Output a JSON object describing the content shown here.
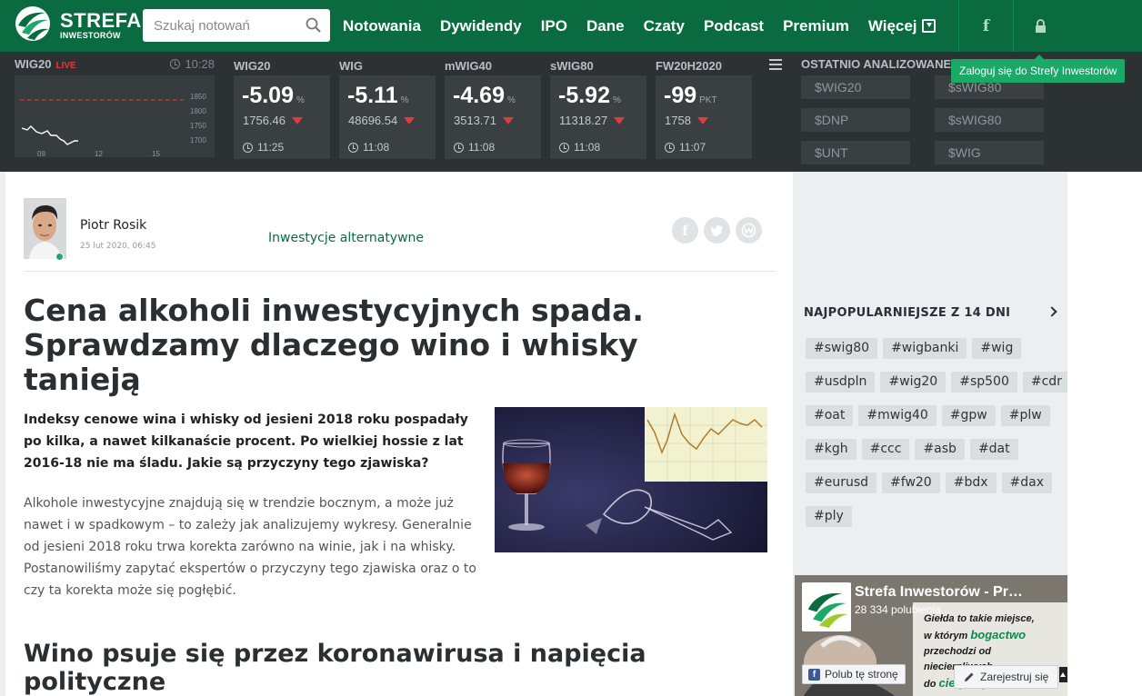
{
  "brand": {
    "name": "STREFA",
    "subtitle": "INWESTORÓW",
    "color": "#0b6b40",
    "accent": "#1aa967"
  },
  "search": {
    "placeholder": "Szukaj notowań",
    "icon": "search-icon"
  },
  "nav": {
    "links": [
      "Notowania",
      "Dywidendy",
      "IPO",
      "Dane",
      "Czaty",
      "Podcast",
      "Premium",
      "Więcej"
    ],
    "facebook_icon": "facebook-icon",
    "lock_icon": "lock-icon"
  },
  "login_tooltip": "Zaloguj się do Strefy Inwestorów",
  "ticker": {
    "live_index": {
      "name": "WIG20",
      "live_label": "LIVE",
      "time": "10:28",
      "y_ticks": [
        "1850",
        "1800",
        "1750",
        "1700"
      ],
      "x_ticks": [
        "09",
        "12",
        "15"
      ]
    },
    "indices": [
      {
        "name": "WIG20",
        "change": "-5.09",
        "unit": "%",
        "value": "1756.46",
        "time": "11:25"
      },
      {
        "name": "WIG",
        "change": "-5.11",
        "unit": "%",
        "value": "48696.54",
        "time": "11:08"
      },
      {
        "name": "mWIG40",
        "change": "-4.69",
        "unit": "%",
        "value": "3513.71",
        "time": "11:08"
      },
      {
        "name": "sWIG80",
        "change": "-5.92",
        "unit": "%",
        "value": "11318.27",
        "time": "11:08"
      },
      {
        "name": "FW20H2020",
        "change": "-99",
        "unit": "PKT",
        "value": "1758",
        "time": "11:07"
      }
    ],
    "recent_label": "OSTATNIO ANALIZOWANE",
    "recent": [
      "$WIG20",
      "$sWIG80",
      "$DNP",
      "$sWIG80",
      "$UNT",
      "$WIG"
    ]
  },
  "article": {
    "author": "Piotr Rosik",
    "date": "25 lut 2020, 06:45",
    "category": "Inwestycje alternatywne",
    "title_line1": "Cena alkoholi inwestycyjnych spada.",
    "title_line2": "Sprawdzamy dlaczego wino i whisky tanieją",
    "lead": "Indeksy cenowe wina i whisky od jesieni 2018 roku pospadały po kilka, a nawet kilkanaście procent. Po wielkiej hossie z lat 2016-18 nie ma śladu. Jakie są przyczyny tego zjawiska?",
    "body": "Alkohole inwestycyjne znajdują się w trendzie bocznym, a może już nawet i w spadkowym – to zależy jak analizujemy wykresy. Generalnie od jesieni 2018 roku trwa korekta zarówno na winie, jak i na whisky. Postanowiliśmy zapytać ekspertów o przyczyny tego zjawiska oraz o to czy ta korekta może się pogłębić.",
    "subheading": "Wino psuje się przez koronawirusa i napięcia polityczne",
    "share_icons": [
      "facebook-icon",
      "twitter-icon",
      "wykop-icon"
    ]
  },
  "sidebar": {
    "popular_label": "NAJPOPULARNIEJSZE Z 14 DNI",
    "tag_rows": [
      [
        "#swig80",
        "#wigbanki",
        "#wig"
      ],
      [
        "#usdpln",
        "#wig20",
        "#sp500",
        "#cdr"
      ],
      [
        "#oat",
        "#mwig40",
        "#gpw",
        "#plw"
      ],
      [
        "#kgh",
        "#ccc",
        "#asb",
        "#dat"
      ],
      [
        "#eurusd",
        "#fw20",
        "#bdx",
        "#dax"
      ],
      [
        "#ply"
      ]
    ],
    "fb_widget": {
      "page_name": "Strefa Inwestorów - Pr…",
      "likes": "28 334 polubienia",
      "slogan_1": "Giełda",
      "slogan_2": "to takie miejsce,",
      "slogan_3": "w którym",
      "slogan_4": "bogactwo",
      "slogan_5": "przechodzi od niecierpliwych",
      "slogan_6": "do",
      "slogan_7": "cierpliwych",
      "like_button": "Polub tę stronę",
      "register_button": "Zarejestruj się"
    }
  }
}
